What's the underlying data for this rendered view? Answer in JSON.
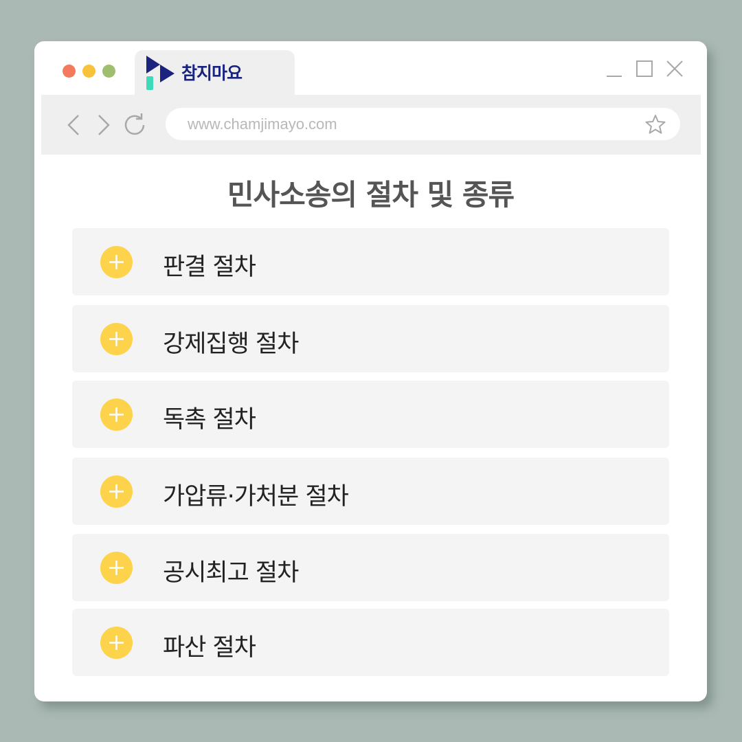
{
  "browser": {
    "tab": {
      "logo_text": "참지마요"
    },
    "address_bar": {
      "url": "www.chamjimayo.com"
    },
    "icons": {
      "back": "chevron-left-icon",
      "forward": "chevron-right-icon",
      "reload": "reload-icon",
      "bookmark": "star-icon",
      "minimize": "minimize-icon",
      "maximize": "maximize-icon",
      "close": "close-icon"
    },
    "colors": {
      "background": "#aab9b4",
      "traffic_red": "#f47a5e",
      "traffic_yellow": "#f8c33a",
      "traffic_green": "#9fbf6e",
      "logo_navy": "#1a237e",
      "logo_mint": "#3ddbb8",
      "accent_yellow": "#fdd34c"
    }
  },
  "page": {
    "title": "민사소송의 절차 및 종류",
    "items": [
      {
        "label": "판결 절차",
        "icon": "plus-icon"
      },
      {
        "label": "강제집행 절차",
        "icon": "plus-icon"
      },
      {
        "label": "독촉 절차",
        "icon": "plus-icon"
      },
      {
        "label": "가압류·가처분 절차",
        "icon": "plus-icon"
      },
      {
        "label": "공시최고 절차",
        "icon": "plus-icon"
      },
      {
        "label": "파산 절차",
        "icon": "plus-icon"
      }
    ]
  }
}
